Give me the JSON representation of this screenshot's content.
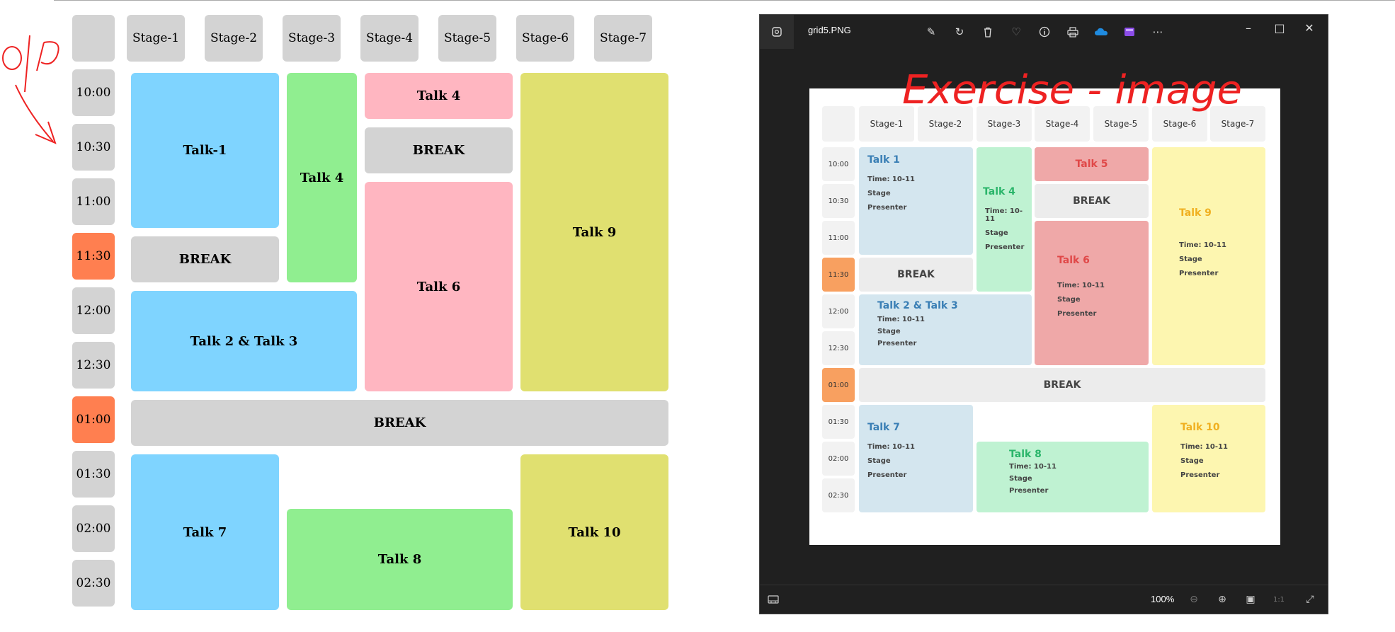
{
  "stages": [
    "Stage-1",
    "Stage-2",
    "Stage-3",
    "Stage-4",
    "Stage-5",
    "Stage-6",
    "Stage-7"
  ],
  "times": [
    "10:00",
    "10:30",
    "11:00",
    "11:30",
    "12:00",
    "12:30",
    "01:00",
    "01:30",
    "02:00",
    "02:30"
  ],
  "talks": {
    "talk1": "Talk-1",
    "talk4a": "Talk 4",
    "talk4b": "Talk 4",
    "break1": "BREAK",
    "break2": "BREAK",
    "break3": "BREAK",
    "talk6": "Talk 6",
    "talk9": "Talk 9",
    "talk23": "Talk 2 & Talk 3",
    "talk7": "Talk 7",
    "talk8": "Talk 8",
    "talk10": "Talk 10"
  },
  "viewer": {
    "filename": "grid5.PNG",
    "zoom": "100%",
    "overlay_text": "Exercise - image",
    "grid": {
      "stages": [
        "Stage-1",
        "Stage-2",
        "Stage-3",
        "Stage-4",
        "Stage-5",
        "Stage-6",
        "Stage-7"
      ],
      "times": [
        "10:00",
        "10:30",
        "11:00",
        "11:30",
        "12:00",
        "12:30",
        "01:00",
        "01:30",
        "02:00",
        "02:30"
      ],
      "cards": {
        "talk1": {
          "title": "Talk 1",
          "time": "Time: 10-11",
          "stage": "Stage",
          "presenter": "Presenter"
        },
        "talk4": {
          "title": "Talk 4",
          "time": "Time: 10-11",
          "stage": "Stage",
          "presenter": "Presenter"
        },
        "talk5": {
          "title": "Talk 5"
        },
        "talk6": {
          "title": "Talk 6",
          "time": "Time: 10-11",
          "stage": "Stage",
          "presenter": "Presenter"
        },
        "talk9": {
          "title": "Talk 9",
          "time": "Time: 10-11",
          "stage": "Stage",
          "presenter": "Presenter"
        },
        "talk23": {
          "title": "Talk 2 & Talk 3",
          "time": "Time: 10-11",
          "stage": "Stage",
          "presenter": "Presenter"
        },
        "talk7": {
          "title": "Talk 7",
          "time": "Time: 10-11",
          "stage": "Stage",
          "presenter": "Presenter"
        },
        "talk8": {
          "title": "Talk 8",
          "time": "Time: 10-11",
          "stage": "Stage",
          "presenter": "Presenter"
        },
        "talk10": {
          "title": "Talk 10",
          "time": "Time: 10-11",
          "stage": "Stage",
          "presenter": "Presenter"
        }
      },
      "break_label": "BREAK"
    }
  },
  "colors": {
    "accent_orange": "#ff7f50",
    "blue": "#7fd4ff",
    "green": "#90ee90",
    "pink": "#ffb6c1",
    "yellow": "#e0e070",
    "grey": "#d3d3d3",
    "annotation_red": "#ee2222"
  },
  "annotation": {
    "label": "o/p"
  }
}
